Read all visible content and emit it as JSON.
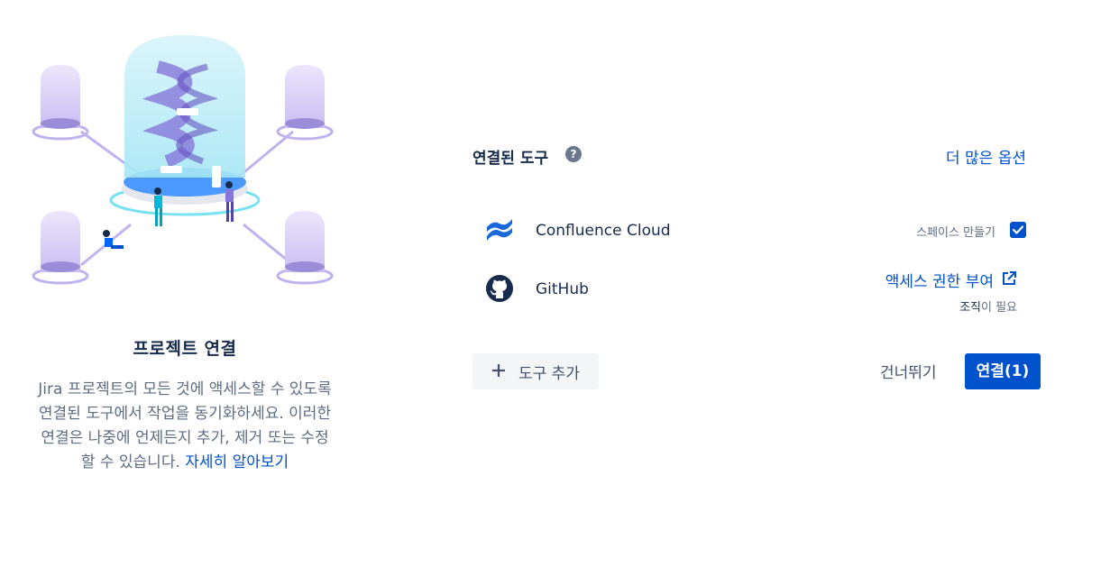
{
  "left": {
    "title": "프로젝트 연결",
    "description": "Jira 프로젝트의 모든 것에 액세스할 수 있도록 연결된 도구에서 작업을 동기화하세요. 이러한 연결은 나중에 언제든지 추가, 제거 또는 수정할 수 있습니다. ",
    "learn_more": "자세히 알아보기"
  },
  "panel": {
    "title": "연결된 도구",
    "help_icon": "question-icon",
    "more_options": "더 많은 옵션",
    "tools": [
      {
        "name": "Confluence Cloud",
        "icon": "confluence-logo",
        "option_label": "스페이스 만들기",
        "option_checked": true
      },
      {
        "name": "GitHub",
        "icon": "github-logo",
        "action_label": "액세스 권한 부여",
        "action_icon": "external-link-icon",
        "requirement_highlight": "조직",
        "requirement_rest": "이 필요"
      }
    ],
    "add_tool": "도구 추가",
    "skip": "건너뛰기",
    "connect": "연결(1)"
  },
  "colors": {
    "primary": "#0052cc",
    "text": "#172b4d",
    "subtle": "#5e6c84",
    "confluence_blue": "#1868db"
  }
}
